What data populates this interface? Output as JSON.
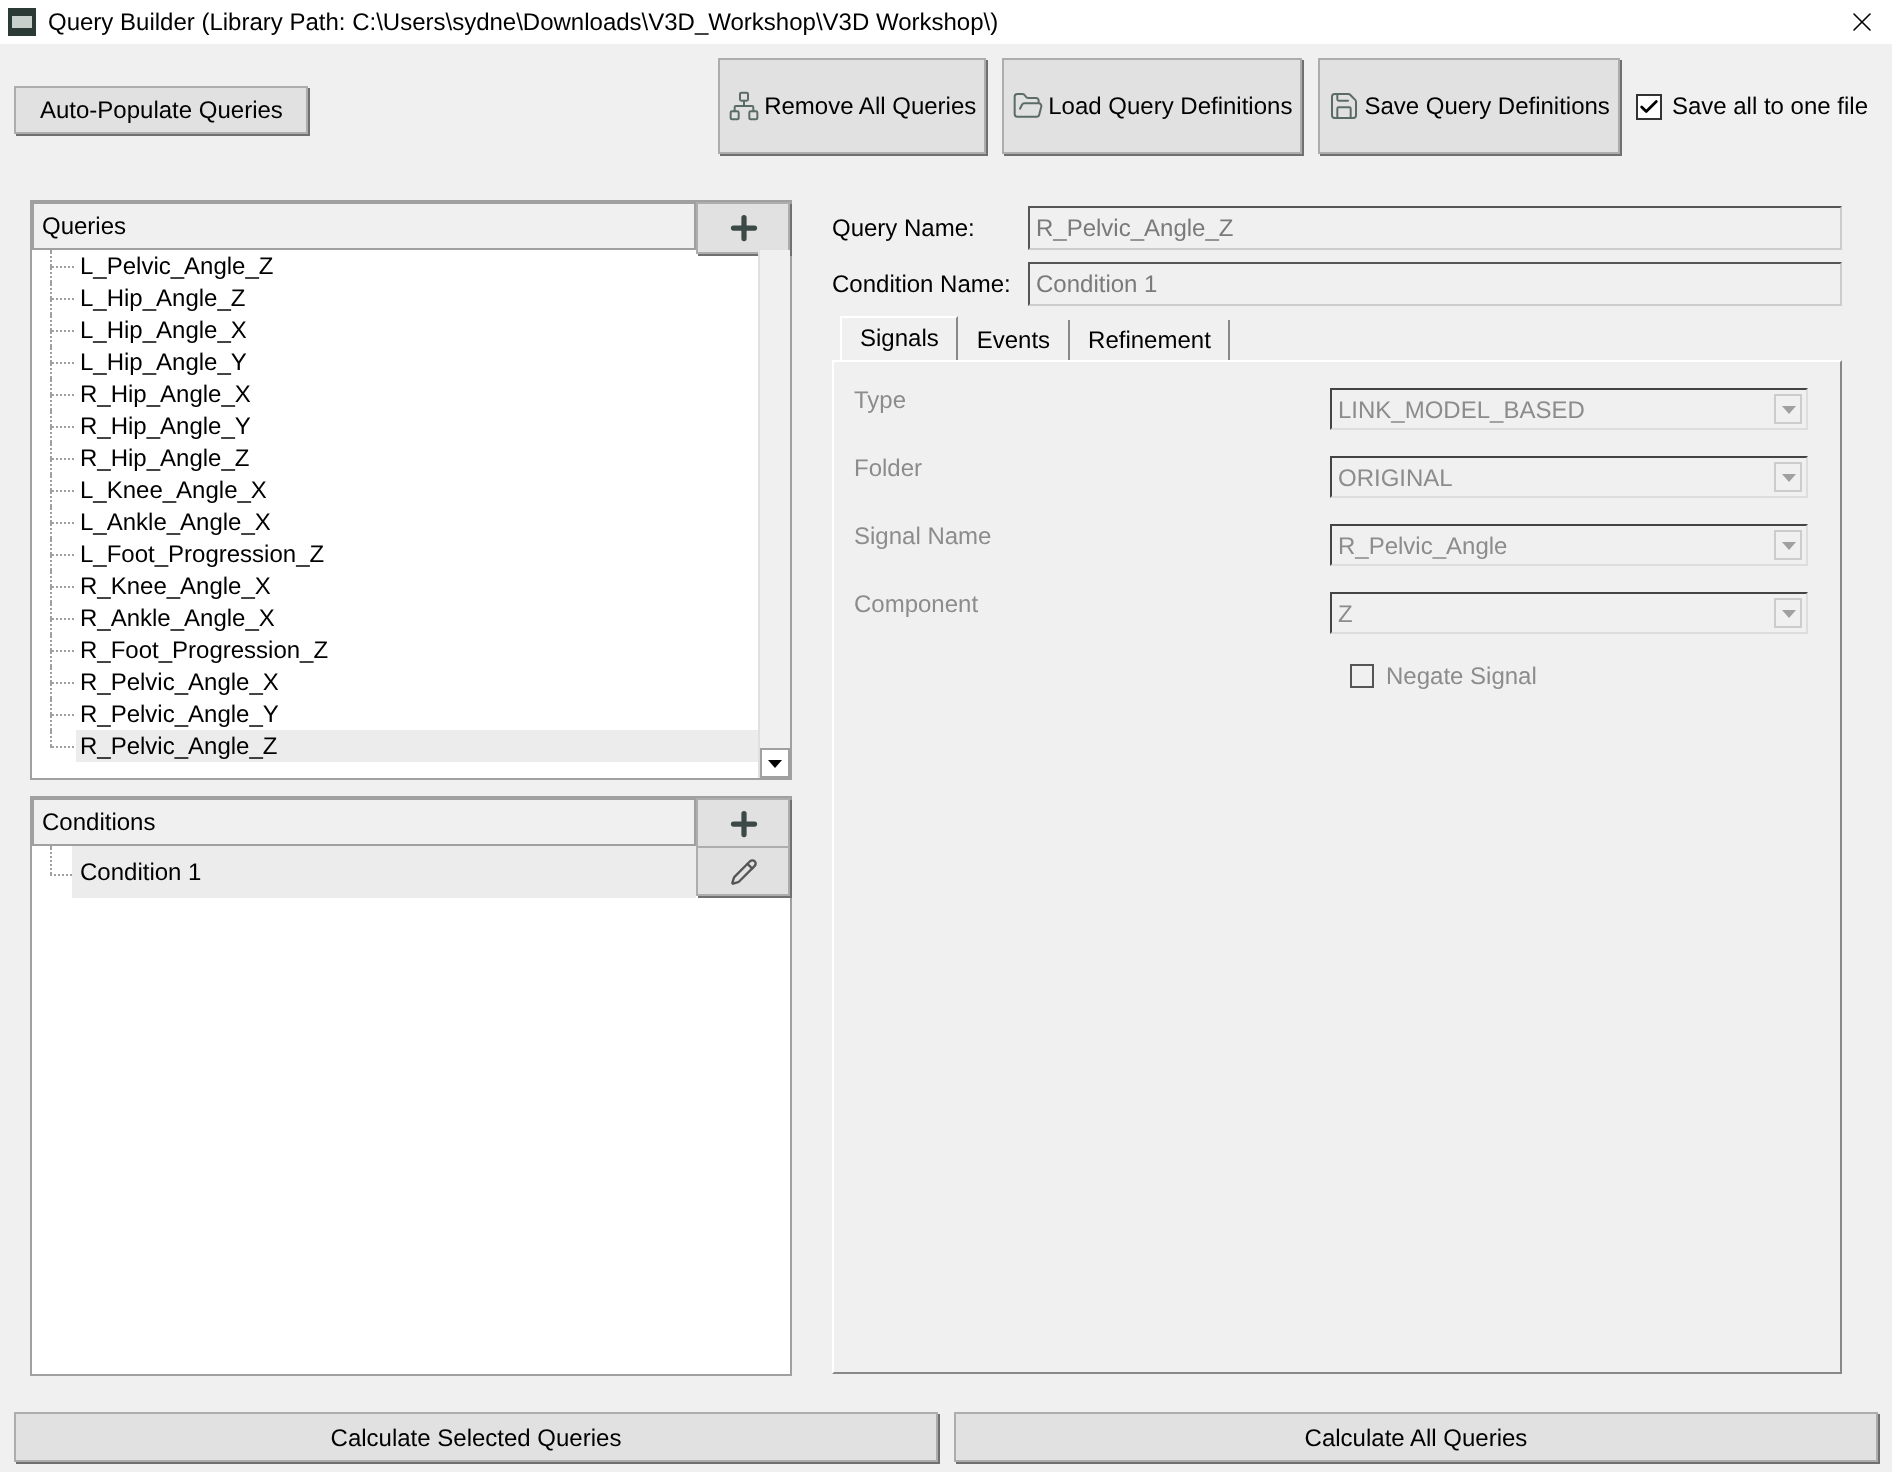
{
  "window": {
    "title": "Query Builder (Library Path: C:\\Users\\sydne\\Downloads\\V3D_Workshop\\V3D Workshop\\)"
  },
  "toolbar": {
    "auto_populate": "Auto-Populate Queries",
    "buttons": [
      "Remove All Queries",
      "Load Query Definitions",
      "Save Query Definitions"
    ],
    "save_all": {
      "label": "Save all to one file",
      "checked": true
    }
  },
  "queries": {
    "header": "Queries",
    "items": [
      {
        "label": "L_Pelvic_Angle_Z",
        "selected": false
      },
      {
        "label": "L_Hip_Angle_Z",
        "selected": false
      },
      {
        "label": "L_Hip_Angle_X",
        "selected": false
      },
      {
        "label": "L_Hip_Angle_Y",
        "selected": false
      },
      {
        "label": "R_Hip_Angle_X",
        "selected": false
      },
      {
        "label": "R_Hip_Angle_Y",
        "selected": false
      },
      {
        "label": "R_Hip_Angle_Z",
        "selected": false
      },
      {
        "label": "L_Knee_Angle_X",
        "selected": false
      },
      {
        "label": "L_Ankle_Angle_X",
        "selected": false
      },
      {
        "label": "L_Foot_Progression_Z",
        "selected": false
      },
      {
        "label": "R_Knee_Angle_X",
        "selected": false
      },
      {
        "label": "R_Ankle_Angle_X",
        "selected": false
      },
      {
        "label": "R_Foot_Progression_Z",
        "selected": false
      },
      {
        "label": "R_Pelvic_Angle_X",
        "selected": false
      },
      {
        "label": "R_Pelvic_Angle_Y",
        "selected": false
      },
      {
        "label": "R_Pelvic_Angle_Z",
        "selected": true
      }
    ]
  },
  "conditions": {
    "header": "Conditions",
    "items": [
      {
        "label": "Condition 1",
        "selected": true
      }
    ]
  },
  "query_name": {
    "label": "Query Name:",
    "value": "R_Pelvic_Angle_Z"
  },
  "condition_name": {
    "label": "Condition Name:",
    "value": "Condition 1"
  },
  "tabs": [
    {
      "label": "Signals",
      "selected": true
    },
    {
      "label": "Events",
      "selected": false
    },
    {
      "label": "Refinement",
      "selected": false
    }
  ],
  "signals": {
    "fields": [
      {
        "label": "Type",
        "value": "LINK_MODEL_BASED"
      },
      {
        "label": "Folder",
        "value": "ORIGINAL"
      },
      {
        "label": "Signal Name",
        "value": "R_Pelvic_Angle"
      },
      {
        "label": "Component",
        "value": "Z"
      }
    ],
    "negate": {
      "label": "Negate Signal",
      "checked": false
    }
  },
  "bottom_buttons": [
    "Calculate Selected Queries",
    "Calculate All Queries"
  ]
}
